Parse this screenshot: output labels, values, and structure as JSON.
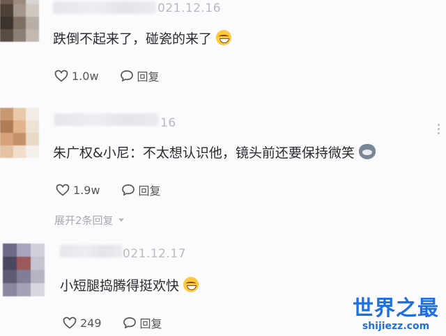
{
  "comments": [
    {
      "date": "021.12.16",
      "text": "跌倒不起来了，碰瓷的来了",
      "emoji": "grinning-face-icon",
      "likes": "1.0w",
      "reply_label": "回复"
    },
    {
      "date": "16",
      "text": "朱广权&小尼：不太想认识他，镜头前还要保持微笑",
      "emoji": "cat-face-icon",
      "likes": "1.9w",
      "reply_label": "回复",
      "expand_label": "展开2条回复"
    },
    {
      "date": "021.12.17",
      "text": "小短腿捣腾得挺欢快",
      "emoji": "grinning-face-icon",
      "likes": "249",
      "reply_label": "回复"
    }
  ],
  "watermark": {
    "title": "世界之最",
    "url": "shijiezz.com"
  },
  "colors": {
    "accent": "#1e6fe0",
    "emoji": "#ffc83d",
    "muted_text": "#a8a8b0"
  }
}
